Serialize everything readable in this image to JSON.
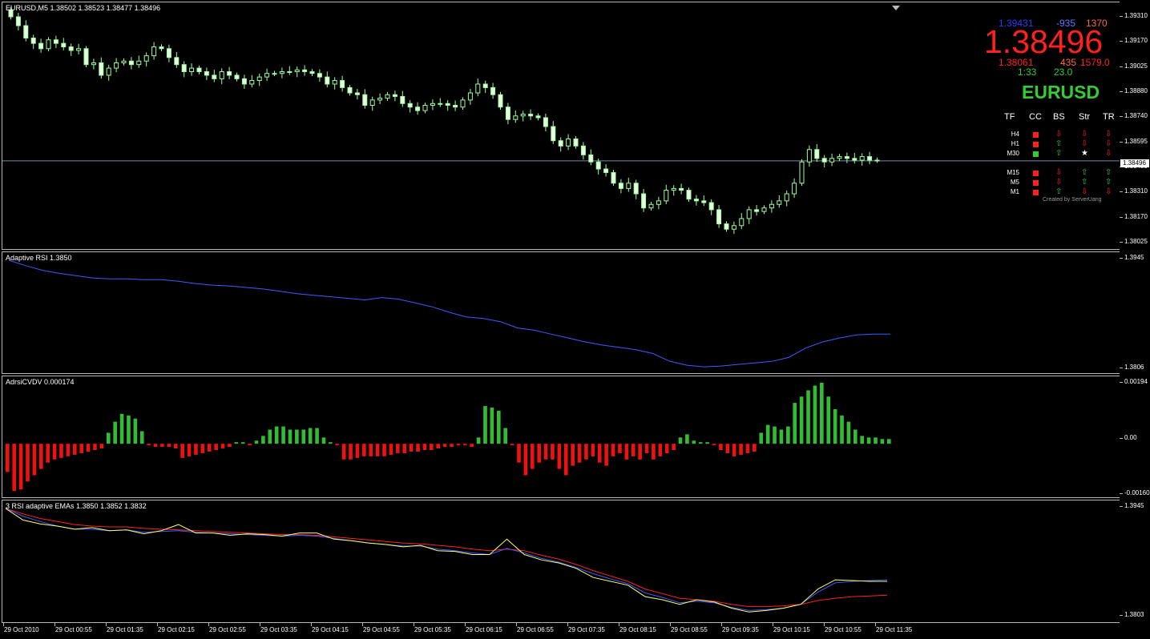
{
  "main": {
    "title": "EURUSD,M5  1.38502 1.38523 1.38477 1.38496",
    "current_price_label": "1.38496",
    "axis_labels": [
      "1.39310",
      "1.39170",
      "1.39025",
      "1.38880",
      "1.38740",
      "1.38595",
      "1.38455",
      "1.38310",
      "1.38170",
      "1.38025"
    ]
  },
  "dashboard": {
    "ask": "1.39431",
    "change": "-935",
    "range": "1370",
    "bid_big": "1.38496",
    "low": "1.38061",
    "pips": "435",
    "spread_val": "1579.0",
    "timer": "1:33",
    "timer2": "23.0",
    "symbol": "EURUSD",
    "headers": [
      "TF",
      "CC",
      "BS",
      "Str",
      "TR"
    ],
    "rows": [
      {
        "tf": "H4",
        "cc": "red",
        "bs": "down",
        "str": "down",
        "tr": "down"
      },
      {
        "tf": "H1",
        "cc": "red",
        "bs": "up",
        "str": "down",
        "tr": "down"
      },
      {
        "tf": "M30",
        "cc": "green",
        "bs": "up",
        "str": "star",
        "tr": "down"
      },
      {
        "tf": "M15",
        "cc": "red",
        "bs": "down",
        "str": "up",
        "tr": "up"
      },
      {
        "tf": "M5",
        "cc": "red",
        "bs": "down",
        "str": "up",
        "tr": "up"
      },
      {
        "tf": "M1",
        "cc": "red",
        "bs": "up",
        "str": "down",
        "tr": "down"
      }
    ],
    "credit": "Created by ServerUang",
    "colors": {
      "blue": "#2a3cff",
      "red": "#ff2020",
      "green": "#33cc33",
      "orange": "#ff6a3a",
      "light_blue": "#5a7aff"
    }
  },
  "rsi": {
    "title": "Adaptive RSI 1.3850",
    "axis_labels": [
      "1.3945",
      "1.3806"
    ]
  },
  "cvdv": {
    "title": "AdrsiCVDV 0.000174",
    "axis_labels": [
      "0.00194",
      "0.00",
      "-0.00160"
    ]
  },
  "emas": {
    "title": "3 RSI adaptive EMAs 1.3850 1.3852 1.3832",
    "axis_labels": [
      "1.3945",
      "1.3803"
    ]
  },
  "time_labels": [
    "29 Oct 2010",
    "29 Oct 00:55",
    "29 Oct 01:35",
    "29 Oct 02:15",
    "29 Oct 02:55",
    "29 Oct 03:35",
    "29 Oct 04:15",
    "29 Oct 04:55",
    "29 Oct 05:35",
    "29 Oct 06:15",
    "29 Oct 06:55",
    "29 Oct 07:35",
    "29 Oct 08:15",
    "29 Oct 08:55",
    "29 Oct 09:35",
    "29 Oct 10:15",
    "29 Oct 10:55",
    "29 Oct 11:35"
  ],
  "chart_data": {
    "type": "candlestick",
    "candle_closes": [
      1.3931,
      1.3926,
      1.3919,
      1.3916,
      1.3913,
      1.3918,
      1.3916,
      1.3914,
      1.3912,
      1.3913,
      1.3904,
      1.3905,
      1.3898,
      1.3902,
      1.3905,
      1.3906,
      1.3904,
      1.3906,
      1.3909,
      1.3914,
      1.3913,
      1.3908,
      1.3904,
      1.39,
      1.3902,
      1.39,
      1.3898,
      1.3896,
      1.39,
      1.3898,
      1.3896,
      1.3893,
      1.3895,
      1.3897,
      1.3899,
      1.3899,
      1.39,
      1.39,
      1.3901,
      1.39,
      1.3899,
      1.3897,
      1.3893,
      1.3895,
      1.3891,
      1.3888,
      1.3887,
      1.3881,
      1.3884,
      1.3885,
      1.3887,
      1.3886,
      1.3882,
      1.388,
      1.3878,
      1.3881,
      1.3882,
      1.3882,
      1.3881,
      1.388,
      1.3884,
      1.3888,
      1.3893,
      1.3891,
      1.3887,
      1.388,
      1.3873,
      1.3875,
      1.3876,
      1.3875,
      1.3874,
      1.3869,
      1.3861,
      1.3858,
      1.3862,
      1.3858,
      1.3853,
      1.3849,
      1.3845,
      1.3843,
      1.3837,
      1.3834,
      1.3837,
      1.3831,
      1.3823,
      1.3825,
      1.3827,
      1.3833,
      1.3834,
      1.3833,
      1.3828,
      1.3827,
      1.3826,
      1.3822,
      1.3814,
      1.3811,
      1.3813,
      1.3817,
      1.3822,
      1.3821,
      1.3823,
      1.3825,
      1.3827,
      1.3831,
      1.3837,
      1.3849,
      1.3856,
      1.3851,
      1.3849,
      1.3851,
      1.3852,
      1.3851,
      1.385,
      1.3852,
      1.385,
      1.385
    ],
    "rsi_series": [
      1.3945,
      1.3938,
      1.3932,
      1.3928,
      1.3925,
      1.3922,
      1.3921,
      1.3921,
      1.392,
      1.392,
      1.3918,
      1.3915,
      1.3913,
      1.3912,
      1.391,
      1.3908,
      1.3905,
      1.3902,
      1.39,
      1.3898,
      1.3896,
      1.3894,
      1.3897,
      1.3895,
      1.389,
      1.3885,
      1.3878,
      1.3872,
      1.387,
      1.3866,
      1.3858,
      1.3855,
      1.385,
      1.3845,
      1.384,
      1.3836,
      1.3833,
      1.383,
      1.3825,
      1.3815,
      1.381,
      1.3808,
      1.3809,
      1.3811,
      1.3813,
      1.3815,
      1.382,
      1.3832,
      1.384,
      1.3845,
      1.3849,
      1.385,
      1.385
    ],
    "cvdv_bars": [
      -0.0009,
      -0.0015,
      -0.00145,
      -0.0012,
      -0.001,
      -0.0008,
      -0.0006,
      -0.0005,
      -0.00045,
      -0.0004,
      -0.00035,
      -0.0003,
      -0.00025,
      -0.0002,
      -0.00015,
      0.00035,
      0.0007,
      0.00095,
      0.0009,
      0.0008,
      0.0004,
      -5e-05,
      -0.0001,
      -0.0001,
      -0.0001,
      -0.00015,
      -0.00045,
      -0.0004,
      -0.00035,
      -0.0003,
      -0.00025,
      -0.0002,
      -0.00015,
      -0.0001,
      5e-05,
      5e-05,
      -5e-05,
      0.0001,
      0.00025,
      0.00045,
      0.00055,
      0.00055,
      0.00045,
      0.00045,
      0.00045,
      0.0005,
      0.0005,
      0.0002,
      5e-05,
      -5e-05,
      -0.0005,
      -0.0005,
      -0.00045,
      -0.0004,
      -0.0004,
      -0.0004,
      -0.0004,
      -0.00035,
      -0.0003,
      -0.0003,
      -0.00025,
      -0.00025,
      -0.0002,
      -0.0002,
      -0.00015,
      -0.0001,
      -0.0001,
      -5e-05,
      -5e-05,
      -0.0001,
      0.0002,
      0.0012,
      0.00115,
      0.00105,
      0.0005,
      -5e-05,
      -0.0006,
      -0.001,
      -0.0008,
      -0.0006,
      -0.0005,
      -0.0005,
      -0.0008,
      -0.001,
      -0.0007,
      -0.0006,
      -0.0005,
      -0.0004,
      -0.0006,
      -0.0007,
      -0.0004,
      -0.0003,
      -0.0005,
      -0.0004,
      -0.0005,
      -0.0003,
      -0.0005,
      -0.0004,
      -0.0003,
      -0.0002,
      0.0002,
      0.0003,
      0.0001,
      5e-05,
      5e-05,
      -5e-05,
      -0.0002,
      -0.0003,
      -0.0004,
      -0.00035,
      -0.0003,
      -0.00025,
      0.00035,
      0.0006,
      0.00055,
      0.00045,
      0.00055,
      0.0013,
      0.0015,
      0.0017,
      0.00185,
      0.00194,
      0.0015,
      0.0011,
      0.0009,
      0.0007,
      0.00045,
      0.00025,
      0.0002,
      0.0002,
      0.00015,
      0.00015
    ],
    "ema_yellow": [
      1.3945,
      1.393,
      1.3925,
      1.3922,
      1.3918,
      1.392,
      1.3916,
      1.3917,
      1.3912,
      1.3916,
      1.3924,
      1.3913,
      1.3913,
      1.391,
      1.3912,
      1.3911,
      1.3909,
      1.3913,
      1.3913,
      1.3905,
      1.3903,
      1.39,
      1.3898,
      1.3895,
      1.3897,
      1.389,
      1.3889,
      1.3885,
      1.3885,
      1.3905,
      1.3885,
      1.3878,
      1.3874,
      1.3867,
      1.3855,
      1.385,
      1.3845,
      1.383,
      1.3826,
      1.382,
      1.3826,
      1.3823,
      1.3815,
      1.381,
      1.3812,
      1.3815,
      1.382,
      1.384,
      1.3852,
      1.3851,
      1.385,
      1.385
    ],
    "ema_blue": [
      1.3945,
      1.3935,
      1.3928,
      1.3922,
      1.3918,
      1.3918,
      1.3916,
      1.3917,
      1.3914,
      1.3915,
      1.3916,
      1.3914,
      1.3913,
      1.3912,
      1.3911,
      1.391,
      1.3909,
      1.391,
      1.3909,
      1.3906,
      1.3903,
      1.39,
      1.3898,
      1.3896,
      1.3896,
      1.3892,
      1.389,
      1.3887,
      1.3885,
      1.3893,
      1.3887,
      1.388,
      1.3875,
      1.3868,
      1.386,
      1.3853,
      1.3847,
      1.3835,
      1.3829,
      1.3822,
      1.3824,
      1.3822,
      1.3816,
      1.3812,
      1.3813,
      1.3815,
      1.382,
      1.3836,
      1.3848,
      1.385,
      1.3851,
      1.3852
    ],
    "ema_red": [
      1.3945,
      1.3938,
      1.3932,
      1.3928,
      1.3924,
      1.3922,
      1.3921,
      1.3921,
      1.3919,
      1.3918,
      1.3917,
      1.3916,
      1.3915,
      1.3914,
      1.3913,
      1.3912,
      1.3911,
      1.3911,
      1.391,
      1.3908,
      1.3906,
      1.3904,
      1.3902,
      1.39,
      1.3899,
      1.3897,
      1.3895,
      1.3892,
      1.389,
      1.3892,
      1.389,
      1.3884,
      1.3879,
      1.3872,
      1.3864,
      1.3857,
      1.385,
      1.384,
      1.3834,
      1.3828,
      1.3826,
      1.3824,
      1.382,
      1.3817,
      1.3817,
      1.3818,
      1.382,
      1.3825,
      1.3828,
      1.383,
      1.3831,
      1.3832
    ]
  }
}
